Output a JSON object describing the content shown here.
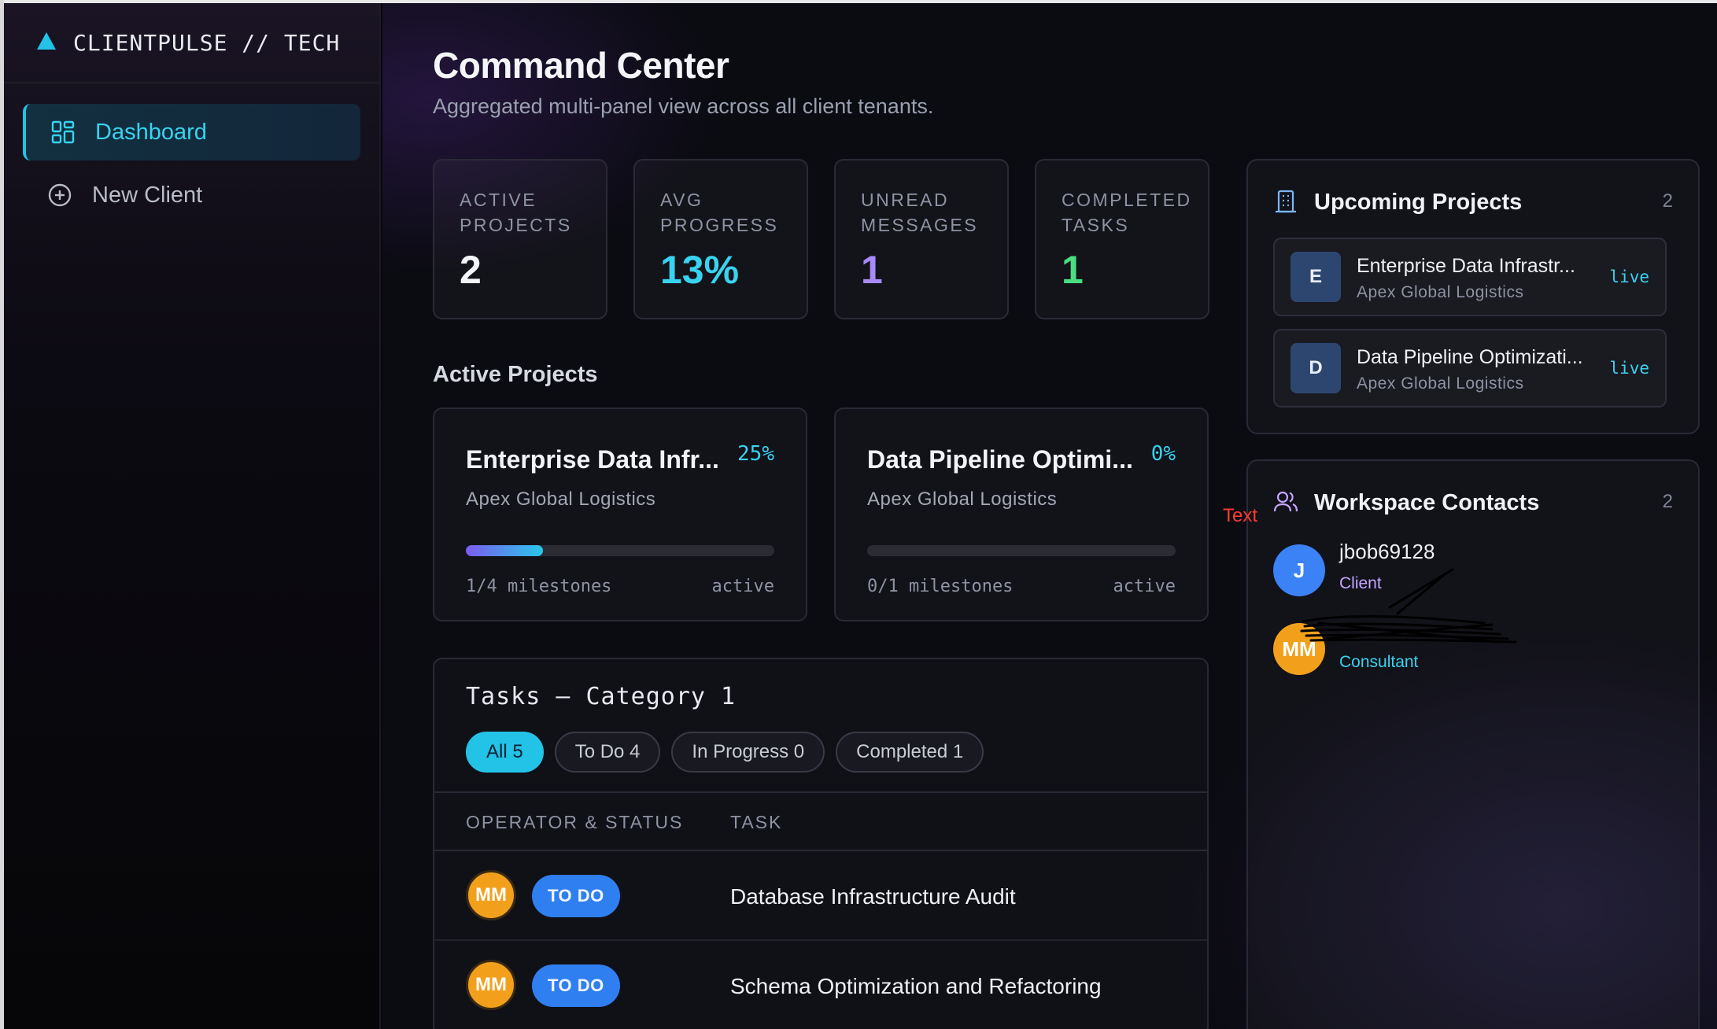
{
  "brand": {
    "name": "CLIENTPULSE // TECH",
    "icon": "triangle-logo-icon",
    "accent": "#22c3e6"
  },
  "sidebar": {
    "items": [
      {
        "label": "Dashboard",
        "icon": "grid-icon",
        "active": true
      },
      {
        "label": "New Client",
        "icon": "plus-circle-icon",
        "active": false
      }
    ]
  },
  "header": {
    "title": "Command Center",
    "subtitle": "Aggregated multi-panel view across all client tenants."
  },
  "stats": [
    {
      "label": "ACTIVE PROJECTS",
      "value": "2",
      "color": "#f4f5f8"
    },
    {
      "label": "AVG PROGRESS",
      "value": "13%",
      "color": "#38d3f0"
    },
    {
      "label": "UNREAD MESSAGES",
      "value": "1",
      "color": "#a78bfa"
    },
    {
      "label": "COMPLETED TASKS",
      "value": "1",
      "color": "#4ade80"
    }
  ],
  "active_projects": {
    "title": "Active Projects",
    "items": [
      {
        "name": "Enterprise Data Infr...",
        "percent": "25%",
        "progress": 0.25,
        "client": "Apex Global Logistics",
        "milestones": "1/4 milestones",
        "status": "active"
      },
      {
        "name": "Data Pipeline Optimi...",
        "percent": "0%",
        "progress": 0.0,
        "client": "Apex Global Logistics",
        "milestones": "0/1 milestones",
        "status": "active"
      }
    ]
  },
  "annotation": {
    "text": "Text",
    "color": "#ff3b30"
  },
  "tasks": {
    "title": "Tasks — Category 1",
    "filters": [
      {
        "label": "All 5",
        "active": true
      },
      {
        "label": "To Do 4",
        "active": false
      },
      {
        "label": "In Progress 0",
        "active": false
      },
      {
        "label": "Completed 1",
        "active": false
      }
    ],
    "columns": [
      "OPERATOR & STATUS",
      "TASK"
    ],
    "rows": [
      {
        "operator": "MM",
        "status": "TO DO",
        "task": "Database Infrastructure Audit"
      },
      {
        "operator": "MM",
        "status": "TO DO",
        "task": "Schema Optimization and Refactoring"
      }
    ]
  },
  "upcoming": {
    "title": "Upcoming Projects",
    "count": "2",
    "icon": "building-icon",
    "items": [
      {
        "initial": "E",
        "name": "Enterprise Data Infrastr...",
        "client": "Apex Global Logistics",
        "badge": "live"
      },
      {
        "initial": "D",
        "name": "Data Pipeline Optimizati...",
        "client": "Apex Global Logistics",
        "badge": "live"
      }
    ]
  },
  "contacts": {
    "title": "Workspace Contacts",
    "count": "2",
    "icon": "users-icon",
    "items": [
      {
        "initials": "J",
        "name": "jbob69128",
        "role": "Client",
        "avatar_color": "#3b82f6",
        "role_color": "#c4a6ff"
      },
      {
        "initials": "MM",
        "name": "",
        "role": "Consultant",
        "avatar_color": "#f2a01c",
        "role_color": "#38d3f0"
      }
    ]
  }
}
